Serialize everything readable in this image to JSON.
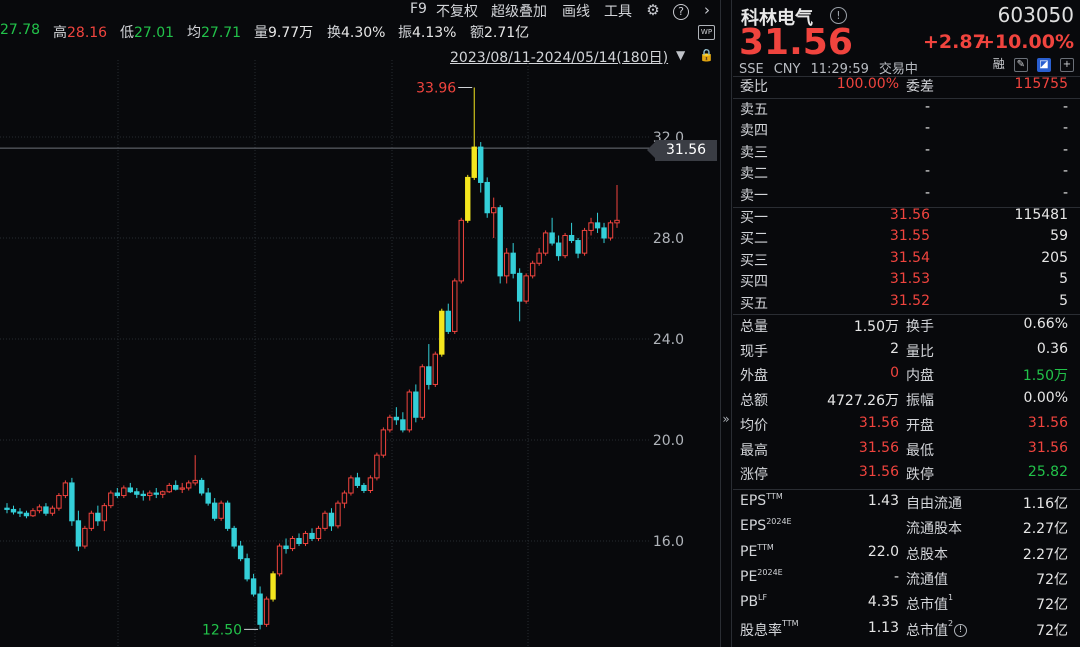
{
  "info_bar": [
    {
      "label": "",
      "value": "27.78",
      "color": "green",
      "x": 0
    },
    {
      "label": "高",
      "value": "28.16",
      "color": "red",
      "x": 53
    },
    {
      "label": "低",
      "value": "27.01",
      "color": "green",
      "x": 120
    },
    {
      "label": "均",
      "value": "27.71",
      "color": "green",
      "x": 187
    },
    {
      "label": "量",
      "value": "9.77万",
      "color": "white",
      "x": 254
    },
    {
      "label": "换",
      "value": "4.30%",
      "color": "white",
      "x": 327
    },
    {
      "label": "振",
      "value": "4.13%",
      "color": "white",
      "x": 398
    },
    {
      "label": "额",
      "value": "2.71亿",
      "color": "white",
      "x": 470
    }
  ],
  "toolbar": {
    "f9": "F9",
    "no_adjust": "不复权",
    "overlay": "超级叠加",
    "draw": "画线",
    "tools": "工具"
  },
  "date_range": "2023/08/11-2024/05/14(180日)",
  "wp_badge": "WP",
  "price_tag": "31.56",
  "quote": {
    "name": "科林电气",
    "code": "603050",
    "price": "31.56",
    "change": "+2.87",
    "change_pct": "+10.00%",
    "market": "SSE",
    "currency": "CNY",
    "time": "11:29:59",
    "status": "交易中",
    "rong": "融",
    "ratio_label": "委比",
    "ratio_value": "100.00%",
    "diff_label": "委差",
    "diff_value": "115755",
    "asks": [
      {
        "label": "卖五",
        "price": "-",
        "vol": "-"
      },
      {
        "label": "卖四",
        "price": "-",
        "vol": "-"
      },
      {
        "label": "卖三",
        "price": "-",
        "vol": "-"
      },
      {
        "label": "卖二",
        "price": "-",
        "vol": "-"
      },
      {
        "label": "卖一",
        "price": "-",
        "vol": "-"
      }
    ],
    "bids": [
      {
        "label": "买一",
        "price": "31.56",
        "vol": "115481"
      },
      {
        "label": "买二",
        "price": "31.55",
        "vol": "59"
      },
      {
        "label": "买三",
        "price": "31.54",
        "vol": "205"
      },
      {
        "label": "买四",
        "price": "31.53",
        "vol": "5"
      },
      {
        "label": "买五",
        "price": "31.52",
        "vol": "5"
      }
    ],
    "stats": [
      {
        "l1": "总量",
        "v1": "1.50万",
        "c1": "white",
        "l2": "换手",
        "v2": "0.66%",
        "c2": "white"
      },
      {
        "l1": "现手",
        "v1": "2",
        "c1": "white",
        "l2": "量比",
        "v2": "0.36",
        "c2": "white"
      },
      {
        "l1": "外盘",
        "v1": "0",
        "c1": "red",
        "l2": "内盘",
        "v2": "1.50万",
        "c2": "green"
      },
      {
        "l1": "总额",
        "v1": "4727.26万",
        "c1": "white",
        "l2": "振幅",
        "v2": "0.00%",
        "c2": "white"
      },
      {
        "l1": "均价",
        "v1": "31.56",
        "c1": "red",
        "l2": "开盘",
        "v2": "31.56",
        "c2": "red"
      },
      {
        "l1": "最高",
        "v1": "31.56",
        "c1": "red",
        "l2": "最低",
        "v2": "31.56",
        "c2": "red"
      },
      {
        "l1": "涨停",
        "v1": "31.56",
        "c1": "red",
        "l2": "跌停",
        "v2": "25.82",
        "c2": "green"
      }
    ],
    "fundamentals": [
      {
        "l1": "EPS",
        "s1": "TTM",
        "v1": "1.43",
        "l2": "自由流通",
        "s2": "",
        "v2": "1.16亿"
      },
      {
        "l1": "EPS",
        "s1": "2024E",
        "v1": "",
        "l2": "流通股本",
        "s2": "",
        "v2": "2.27亿"
      },
      {
        "l1": "PE",
        "s1": "TTM",
        "v1": "22.0",
        "l2": "总股本",
        "s2": "",
        "v2": "2.27亿"
      },
      {
        "l1": "PE",
        "s1": "2024E",
        "v1": "-",
        "l2": "流通值",
        "s2": "",
        "v2": "72亿"
      },
      {
        "l1": "PB",
        "s1": "LF",
        "v1": "4.35",
        "l2": "总市值",
        "s2": "1",
        "v2": "72亿"
      },
      {
        "l1": "股息率",
        "s1": "TTM",
        "v1": "1.13",
        "l2": "总市值",
        "s2": "2",
        "v2": "72亿"
      }
    ]
  },
  "chart_data": {
    "type": "candlestick",
    "y_ticks": [
      "32.0",
      "28.0",
      "24.0",
      "20.0",
      "16.0"
    ],
    "ylim": [
      12.1,
      35.3
    ],
    "last_price": 31.56,
    "high_label": "33.96",
    "low_label": "12.50",
    "high_value": 33.96,
    "low_value": 12.5,
    "colors": {
      "up": "#f0443e",
      "down": "#34cfd8",
      "limit": "#f4e61e",
      "grid": "#262a30"
    },
    "candles": [
      [
        17.3,
        17.5,
        17.1,
        17.25
      ],
      [
        17.25,
        17.4,
        17.05,
        17.15
      ],
      [
        17.15,
        17.3,
        16.95,
        17.1
      ],
      [
        17.1,
        17.2,
        16.9,
        17.0
      ],
      [
        17.0,
        17.3,
        16.95,
        17.2
      ],
      [
        17.2,
        17.45,
        17.1,
        17.35
      ],
      [
        17.35,
        17.5,
        17.0,
        17.1
      ],
      [
        17.1,
        17.4,
        17.0,
        17.3
      ],
      [
        17.3,
        17.9,
        17.2,
        17.8
      ],
      [
        17.8,
        18.4,
        17.7,
        18.3
      ],
      [
        18.3,
        18.5,
        16.6,
        16.8
      ],
      [
        16.8,
        17.2,
        15.6,
        15.8
      ],
      [
        15.8,
        16.6,
        15.7,
        16.5
      ],
      [
        16.5,
        17.2,
        16.4,
        17.1
      ],
      [
        17.1,
        17.4,
        16.6,
        16.8
      ],
      [
        16.8,
        17.5,
        16.4,
        17.4
      ],
      [
        17.4,
        18.0,
        17.3,
        17.9
      ],
      [
        17.9,
        18.1,
        17.7,
        17.8
      ],
      [
        17.8,
        18.2,
        17.7,
        18.1
      ],
      [
        18.1,
        18.3,
        17.9,
        17.95
      ],
      [
        17.95,
        18.1,
        17.7,
        17.85
      ],
      [
        17.85,
        18.0,
        17.6,
        17.8
      ],
      [
        17.8,
        18.0,
        17.6,
        17.9
      ],
      [
        17.9,
        18.1,
        17.7,
        17.85
      ],
      [
        17.85,
        18.0,
        17.7,
        17.95
      ],
      [
        17.95,
        18.3,
        17.9,
        18.2
      ],
      [
        18.2,
        18.4,
        18.0,
        18.05
      ],
      [
        18.05,
        18.3,
        17.9,
        18.1
      ],
      [
        18.1,
        18.4,
        18.0,
        18.3
      ],
      [
        18.3,
        19.4,
        18.2,
        18.4
      ],
      [
        18.4,
        18.5,
        17.8,
        17.9
      ],
      [
        17.9,
        18.1,
        17.4,
        17.5
      ],
      [
        17.5,
        17.7,
        16.8,
        16.9
      ],
      [
        16.9,
        17.6,
        16.8,
        17.5
      ],
      [
        17.5,
        17.6,
        16.4,
        16.5
      ],
      [
        16.5,
        16.6,
        15.7,
        15.8
      ],
      [
        15.8,
        16.0,
        15.2,
        15.3
      ],
      [
        15.3,
        15.5,
        14.4,
        14.5
      ],
      [
        14.5,
        14.7,
        13.8,
        13.9
      ],
      [
        13.9,
        14.2,
        12.5,
        12.7
      ],
      [
        12.7,
        13.8,
        12.6,
        13.7
      ],
      [
        13.7,
        14.8,
        13.6,
        14.7
      ],
      [
        14.7,
        15.9,
        14.6,
        15.8
      ],
      [
        15.8,
        16.1,
        15.5,
        15.7
      ],
      [
        15.7,
        16.2,
        15.6,
        16.1
      ],
      [
        16.1,
        16.3,
        15.8,
        15.9
      ],
      [
        15.9,
        16.4,
        15.8,
        16.3
      ],
      [
        16.3,
        16.5,
        16.0,
        16.1
      ],
      [
        16.1,
        16.6,
        16.0,
        16.5
      ],
      [
        16.5,
        17.2,
        16.4,
        17.1
      ],
      [
        17.1,
        17.3,
        16.4,
        16.6
      ],
      [
        16.6,
        17.6,
        16.5,
        17.5
      ],
      [
        17.5,
        18.0,
        17.3,
        17.9
      ],
      [
        17.9,
        18.6,
        17.8,
        18.5
      ],
      [
        18.5,
        18.7,
        18.1,
        18.2
      ],
      [
        18.2,
        18.3,
        17.9,
        18.0
      ],
      [
        18.0,
        18.6,
        17.9,
        18.5
      ],
      [
        18.5,
        19.5,
        18.4,
        19.4
      ],
      [
        19.4,
        20.5,
        19.3,
        20.4
      ],
      [
        20.4,
        21.0,
        20.3,
        20.9
      ],
      [
        20.9,
        21.3,
        20.6,
        20.8
      ],
      [
        20.8,
        21.1,
        20.3,
        20.4
      ],
      [
        20.4,
        22.0,
        20.3,
        21.9
      ],
      [
        21.9,
        22.2,
        20.7,
        20.9
      ],
      [
        20.9,
        23.0,
        20.8,
        22.9
      ],
      [
        22.9,
        23.8,
        22.0,
        22.2
      ],
      [
        22.2,
        23.5,
        22.1,
        23.4
      ],
      [
        23.4,
        25.2,
        23.3,
        25.1
      ],
      [
        25.1,
        25.4,
        24.2,
        24.3
      ],
      [
        24.3,
        26.4,
        24.2,
        26.3
      ],
      [
        26.3,
        28.8,
        26.2,
        28.7
      ],
      [
        28.7,
        30.5,
        28.6,
        30.4
      ],
      [
        30.4,
        33.96,
        30.3,
        31.6
      ],
      [
        31.6,
        31.8,
        29.8,
        30.2
      ],
      [
        30.2,
        30.4,
        28.8,
        29.0
      ],
      [
        29.0,
        29.6,
        28.0,
        29.2
      ],
      [
        29.2,
        29.3,
        26.2,
        26.5
      ],
      [
        26.5,
        27.6,
        26.2,
        27.4
      ],
      [
        27.4,
        27.8,
        26.4,
        26.6
      ],
      [
        26.6,
        26.8,
        24.7,
        25.5
      ],
      [
        25.5,
        26.6,
        25.4,
        26.5
      ],
      [
        26.5,
        27.1,
        26.4,
        27.0
      ],
      [
        27.0,
        27.6,
        26.9,
        27.4
      ],
      [
        27.4,
        28.3,
        27.3,
        28.2
      ],
      [
        28.2,
        28.8,
        27.7,
        27.8
      ],
      [
        27.8,
        28.1,
        27.1,
        27.3
      ],
      [
        27.3,
        28.2,
        27.2,
        28.1
      ],
      [
        28.1,
        28.6,
        27.8,
        27.9
      ],
      [
        27.9,
        28.0,
        27.2,
        27.4
      ],
      [
        27.4,
        28.4,
        27.3,
        28.3
      ],
      [
        28.3,
        28.8,
        28.1,
        28.6
      ],
      [
        28.6,
        29.0,
        28.2,
        28.4
      ],
      [
        28.4,
        28.6,
        27.8,
        28.0
      ],
      [
        28.0,
        28.7,
        27.9,
        28.6
      ],
      [
        28.6,
        30.1,
        28.4,
        28.7
      ]
    ],
    "limit_up_days": [
      41,
      67,
      71,
      72
    ]
  }
}
